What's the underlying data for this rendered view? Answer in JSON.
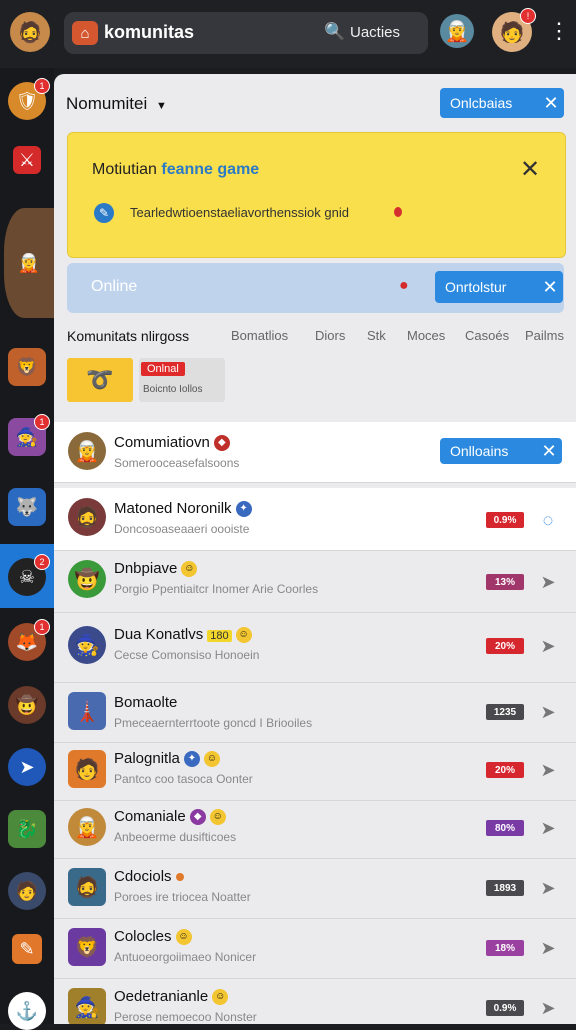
{
  "header": {
    "app_title": "komunitas",
    "search_placeholder": "Uacties",
    "more_icon": "⋮"
  },
  "panel": {
    "heading": "Nomumitei",
    "close_btn_label": "Onlcbaias"
  },
  "banner": {
    "title_prefix": "Motiutian",
    "title_highlight": "feanne game",
    "text": "Tearledwtioenstaeliavorthenssiok gnid"
  },
  "online_bar": {
    "label": "Online",
    "button_label": "Onrtolstur"
  },
  "tabs": {
    "active": "Komunitats nlirgoss",
    "items": [
      "Bomatlios",
      "Diors",
      "Stk",
      "Moces",
      "Casoés",
      "Pailms"
    ]
  },
  "chip": {
    "badge": "Onlnal",
    "sub": "Boicnto Iollos"
  },
  "rows": [
    {
      "name": "Comumiatiovn",
      "sub": "Somerooceasefalsoons",
      "button": "Onlloains"
    },
    {
      "name": "Matoned Noronilk",
      "sub": "Doncosoaseaaeri oooiste",
      "tag": "0.9%",
      "tagColor": "#d6262e"
    },
    {
      "name": "Dnbpiave",
      "sub": "Porgio Ppentiaitcr Inomer Arie Coorles",
      "tag": "13%",
      "tagColor": "#a0366a"
    },
    {
      "name": "Dua Konatlvs",
      "sub": "Cecse Comonsiso Honoein",
      "tag": "20%",
      "tagColor": "#d6262e",
      "extra": "180"
    },
    {
      "name": "Bomaolte",
      "sub": "Pmeceaernterrtoote goncd I Briooiles",
      "tag": "1235",
      "tagColor": "#4a4a4e"
    },
    {
      "name": "Palognitla",
      "sub": "Pantco coo tasoca Oonter",
      "tag": "20%",
      "tagColor": "#d6262e"
    },
    {
      "name": "Comaniale",
      "sub": "Anbeoerme dusifticoes",
      "tag": "80%",
      "tagColor": "#7a3aa6"
    },
    {
      "name": "Cdociols",
      "sub": "Poroes ire triocea Noatter",
      "tag": "1893",
      "tagColor": "#4a4a4e"
    },
    {
      "name": "Colocles",
      "sub": "Antuoeorgoiimaeo Nonicer",
      "tag": "18%",
      "tagColor": "#9a40a0"
    },
    {
      "name": "Oedetranianle",
      "sub": "Perose nemoecoo Nonster",
      "tag": "0.9%",
      "tagColor": "#4a4a4e"
    }
  ]
}
